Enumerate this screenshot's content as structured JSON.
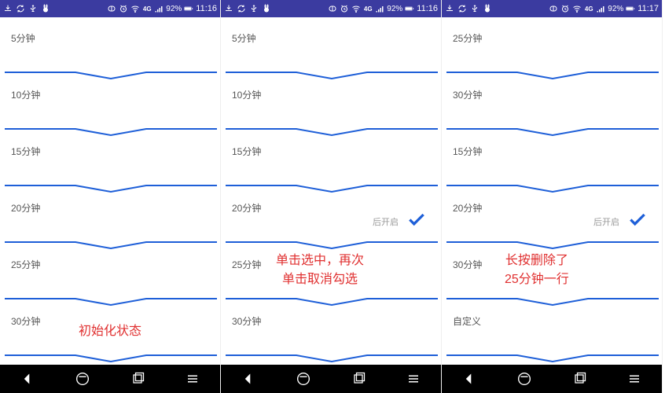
{
  "status": {
    "battery_pct": "92%",
    "time": "11:16",
    "time3": "11:17"
  },
  "screens": [
    {
      "items": [
        {
          "label": "5分钟"
        },
        {
          "label": "10分钟"
        },
        {
          "label": "15分钟"
        },
        {
          "label": "20分钟"
        },
        {
          "label": "25分钟"
        },
        {
          "label": "30分钟"
        }
      ],
      "annotation": "初始化状态",
      "time_key": "time"
    },
    {
      "items": [
        {
          "label": "5分钟"
        },
        {
          "label": "10分钟"
        },
        {
          "label": "15分钟"
        },
        {
          "label": "20分钟",
          "sub": "后开启",
          "checked": true
        },
        {
          "label": "25分钟"
        },
        {
          "label": "30分钟"
        }
      ],
      "annotation": "单击选中，再次\n单击取消勾选",
      "time_key": "time"
    },
    {
      "items": [
        {
          "label": "25分钟"
        },
        {
          "label": "30分钟"
        },
        {
          "label": "15分钟"
        },
        {
          "label": "20分钟",
          "sub": "后开启",
          "checked": true
        },
        {
          "label": "30分钟"
        },
        {
          "label": "自定义"
        }
      ],
      "annotation": "长按删除了\n25分钟一行",
      "time_key": "time3"
    }
  ],
  "colors": {
    "divider": "#1e5fd8",
    "status_bg": "#3b3ba0",
    "annotation": "#e03030"
  }
}
